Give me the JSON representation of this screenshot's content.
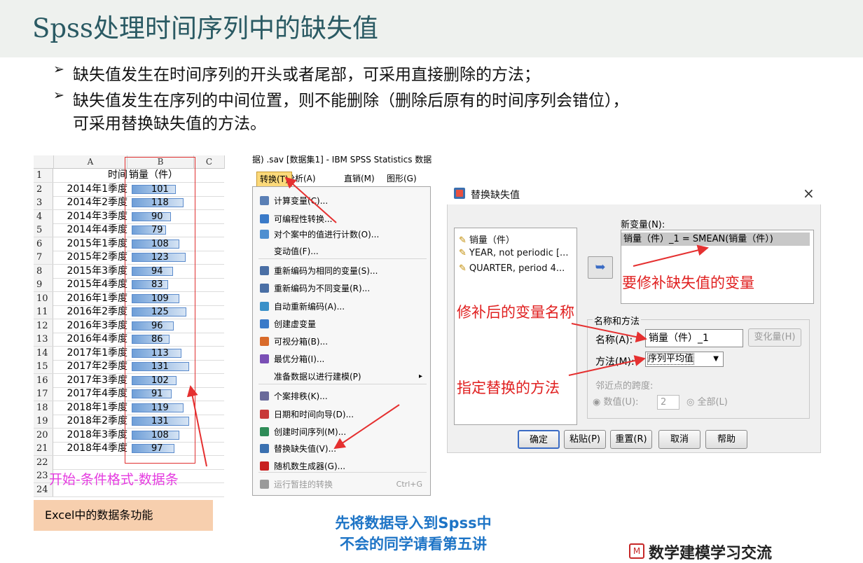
{
  "slide": {
    "title": "Spss处理时间序列中的缺失值",
    "bullets": [
      "缺失值发生在时间序列的开头或者尾部，可采用直接删除的方法；",
      "缺失值发生在序列的中间位置，则不能删除（删除后原有的时间序列会错位），",
      "可采用替换缺失值的方法。"
    ]
  },
  "excel": {
    "columns": [
      "A",
      "B",
      "C"
    ],
    "header_row": {
      "row": "1",
      "a": "时间",
      "b": "销量（件）"
    },
    "rows": [
      {
        "row": "2",
        "a": "2014年1季度",
        "b": 101
      },
      {
        "row": "3",
        "a": "2014年2季度",
        "b": 118
      },
      {
        "row": "4",
        "a": "2014年3季度",
        "b": 90
      },
      {
        "row": "5",
        "a": "2014年4季度",
        "b": 79
      },
      {
        "row": "6",
        "a": "2015年1季度",
        "b": 108
      },
      {
        "row": "7",
        "a": "2015年2季度",
        "b": 123
      },
      {
        "row": "8",
        "a": "2015年3季度",
        "b": 94
      },
      {
        "row": "9",
        "a": "2015年4季度",
        "b": 83
      },
      {
        "row": "10",
        "a": "2016年1季度",
        "b": 109
      },
      {
        "row": "11",
        "a": "2016年2季度",
        "b": 125
      },
      {
        "row": "12",
        "a": "2016年3季度",
        "b": 96
      },
      {
        "row": "13",
        "a": "2016年4季度",
        "b": 86
      },
      {
        "row": "14",
        "a": "2017年1季度",
        "b": 113
      },
      {
        "row": "15",
        "a": "2017年2季度",
        "b": 131
      },
      {
        "row": "16",
        "a": "2017年3季度",
        "b": 102
      },
      {
        "row": "17",
        "a": "2017年4季度",
        "b": 91
      },
      {
        "row": "18",
        "a": "2018年1季度",
        "b": 119
      },
      {
        "row": "19",
        "a": "2018年2季度",
        "b": 131
      },
      {
        "row": "20",
        "a": "2018年3季度",
        "b": 108
      },
      {
        "row": "21",
        "a": "2018年4季度",
        "b": 97
      }
    ],
    "empty_rows": [
      "22",
      "23",
      "24"
    ],
    "annotation": "开始-条件格式-数据条",
    "caption": "Excel中的数据条功能"
  },
  "spss_menu": {
    "window_title": "据) .sav [数据集1] - IBM SPSS Statistics 数据",
    "menubar": [
      "转换(T)",
      "分析(A)",
      "直销(M)",
      "图形(G)"
    ],
    "items": [
      {
        "label": "计算变量(C)...",
        "icon": "calculator-icon",
        "color": "#5a7fb5"
      },
      {
        "label": "可编程性转换...",
        "icon": "plus-box-icon",
        "color": "#3a7ac8"
      },
      {
        "label": "对个案中的值进行计数(O)...",
        "icon": "count-icon",
        "color": "#4f8fd0"
      },
      {
        "label": "变动值(F)...",
        "icon": "",
        "color": ""
      },
      {
        "label": "重新编码为相同的变量(S)...",
        "icon": "recode-same-icon",
        "color": "#4a6fa5"
      },
      {
        "label": "重新编码为不同变量(R)...",
        "icon": "recode-diff-icon",
        "color": "#4a6fa5"
      },
      {
        "label": "自动重新编码(A)...",
        "icon": "auto-recode-icon",
        "color": "#3a90c8"
      },
      {
        "label": "创建虚变量",
        "icon": "plus-box-icon",
        "color": "#3a7ac8"
      },
      {
        "label": "可视分箱(B)...",
        "icon": "bins-icon",
        "color": "#d86a2a"
      },
      {
        "label": "最优分箱(I)...",
        "icon": "optimal-bins-icon",
        "color": "#7a4fb5"
      },
      {
        "label": "准备数据以进行建模(P)",
        "icon": "",
        "color": ""
      },
      {
        "label": "个案排秩(K)...",
        "icon": "rank-icon",
        "color": "#6a6a9a"
      },
      {
        "label": "日期和时间向导(D)...",
        "icon": "calendar-icon",
        "color": "#c83a3a"
      },
      {
        "label": "创建时间序列(M)...",
        "icon": "timeseries-icon",
        "color": "#2e8b57"
      },
      {
        "label": "替换缺失值(V)...",
        "icon": "replace-missing-icon",
        "color": "#3a70b0"
      },
      {
        "label": "随机数生成器(G)...",
        "icon": "dice-icon",
        "color": "#c82020"
      },
      {
        "label": "运行暂挂的转换",
        "icon": "run-pending-icon",
        "color": "#9a9a9a"
      }
    ],
    "shortcut": "Ctrl+G",
    "caption_line1": "先将数据导入到Spss中",
    "caption_line2": "不会的同学请看第五讲"
  },
  "dialog": {
    "title": "替换缺失值",
    "variables": [
      "销量（件）",
      "YEAR, not periodic [...",
      "QUARTER, period 4..."
    ],
    "new_var_label": "新变量(N):",
    "new_var_value": "销量（件）_1 = SMEAN(销量（件）)",
    "group_title": "名称和方法",
    "name_label": "名称(A):",
    "name_value": "销量（件）_1",
    "change_button": "变化量(H)",
    "method_label": "方法(M):",
    "method_value": "序列平均值",
    "span_label": "邻近点的跨度:",
    "radio_num": "数值(U):",
    "span_value": "2",
    "radio_all": "全部(L)",
    "buttons": {
      "ok": "确定",
      "paste": "粘贴(P)",
      "reset": "重置(R)",
      "cancel": "取消",
      "help": "帮助"
    },
    "annotations": {
      "target_var": "要修补缺失值的变量",
      "new_name": "修补后的变量名称",
      "method": "指定替换的方法"
    }
  },
  "watermark": "数学建模学习交流"
}
